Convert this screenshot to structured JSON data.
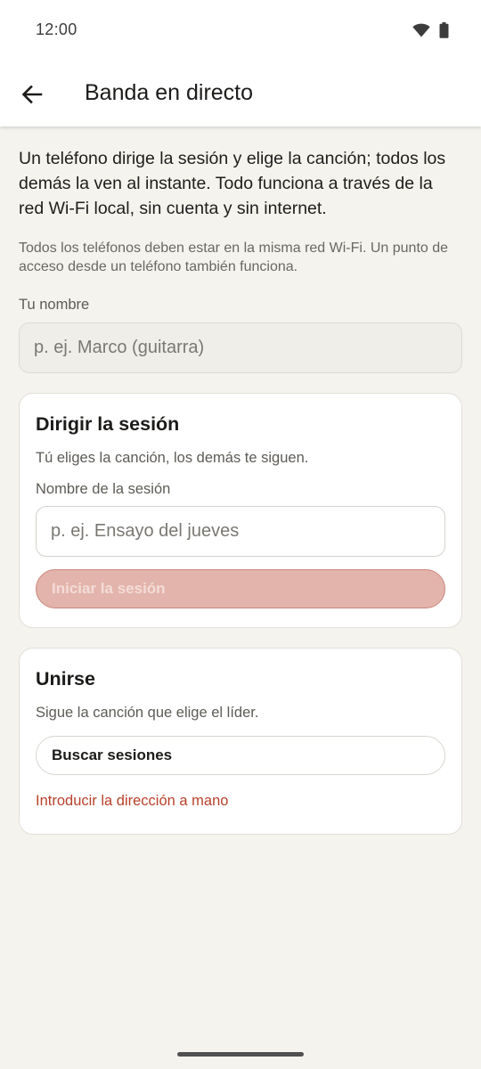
{
  "status_bar": {
    "time": "12:00",
    "icons": [
      "wifi-icon",
      "battery-icon"
    ]
  },
  "app_bar": {
    "back_icon": "arrow-left-icon",
    "title": "Banda en directo"
  },
  "intro": "Un teléfono dirige la sesión y elige la canción; todos los demás la ven al instante. Todo funciona a través de la red Wi-Fi local, sin cuenta y sin internet.",
  "note": "Todos los teléfonos deben estar en la misma red Wi-Fi. Un punto de acceso desde un teléfono también funciona.",
  "name_field": {
    "label": "Tu nombre",
    "value": "",
    "placeholder": "p. ej. Marco (guitarra)"
  },
  "lead_card": {
    "title": "Dirigir la sesión",
    "description": "Tú eliges la canción, los demás te siguen.",
    "session_label": "Nombre de la sesión",
    "session_value": "",
    "session_placeholder": "p. ej. Ensayo del jueves",
    "start_button": "Iniciar la sesión",
    "start_enabled": false
  },
  "join_card": {
    "title": "Unirse",
    "description": "Sigue la canción que elige el líder.",
    "search_button": "Buscar sesiones",
    "manual_link": "Introducir la dirección a mano"
  },
  "colors": {
    "background": "#f5f3ee",
    "surface": "#ffffff",
    "accent": "#b8402a",
    "accent_disabled": "#e3b4ac"
  }
}
